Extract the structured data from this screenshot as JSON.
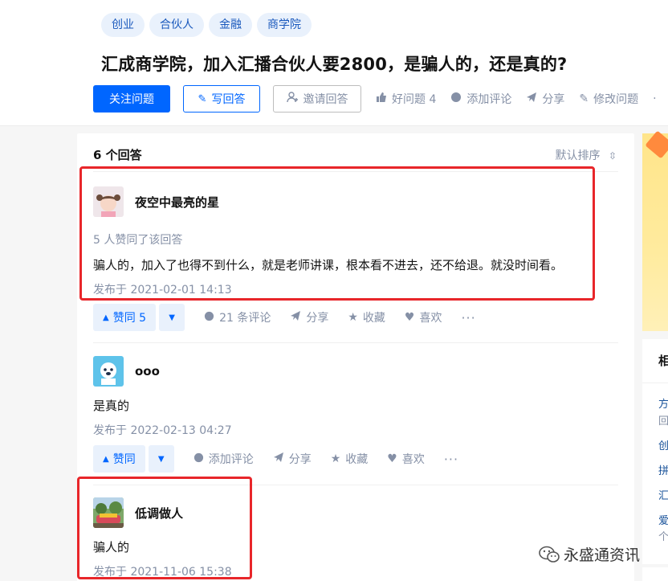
{
  "tags": [
    "创业",
    "合伙人",
    "金融",
    "商学院"
  ],
  "question": {
    "title": "汇成商学院，加入汇播合伙人要2800，是骗人的，还是真的?"
  },
  "actions": {
    "follow": "关注问题",
    "write": "写回答",
    "invite": "邀请回答",
    "good_question": "好问题 4",
    "add_comment": "添加评论",
    "share": "分享",
    "edit": "修改问题",
    "more": "·"
  },
  "list": {
    "count": "6 个回答",
    "sort": "默认排序"
  },
  "answers": [
    {
      "author": "夜空中最亮的星",
      "votes": "5 人赞同了该回答",
      "content": "骗人的，加入了也得不到什么，就是老师讲课，根本看不进去，还不给退。就没时间看。",
      "time": "发布于 2021-02-01 14:13",
      "vote_label": "赞同 5",
      "comments": "21 条评论",
      "share": "分享",
      "collect": "收藏",
      "like": "喜欢",
      "more": "···"
    },
    {
      "author": "ooo",
      "content": "是真的",
      "time": "发布于 2022-02-13 04:27",
      "vote_label": "赞同",
      "comments": "添加评论",
      "share": "分享",
      "collect": "收藏",
      "like": "喜欢",
      "more": "···"
    },
    {
      "author": "低调做人",
      "content": "骗人的",
      "time": "发布于 2021-11-06 15:38"
    }
  ],
  "sidebar": {
    "title": "相",
    "items": [
      "方",
      "回",
      "创",
      "拼",
      "汇",
      "爱",
      "个"
    ]
  },
  "watermark": "永盛通资讯",
  "colors": {
    "primary": "#0066ff",
    "tag_bg": "#e9f1fc",
    "highlight_box": "#e8262a"
  }
}
